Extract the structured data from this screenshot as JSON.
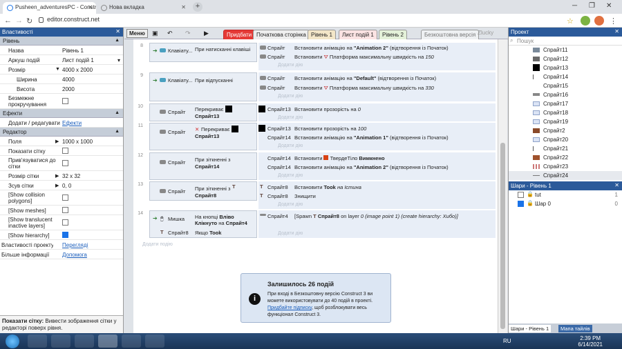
{
  "browser": {
    "tabs": [
      {
        "label": "Pusheen_adventuresPC - Construct"
      },
      {
        "label": "Нова вкладка"
      }
    ],
    "url": "editor.construct.net"
  },
  "left": {
    "title": "Властивості",
    "level_section": "Рівень",
    "name_k": "Назва",
    "name_v": "Рівень 1",
    "sheet_k": "Аркуш подій",
    "sheet_v": "Лист подій 1",
    "size_k": "Розмір",
    "size_v": "4000 x 2000",
    "width_k": "Ширина",
    "width_v": "4000",
    "height_k": "Висота",
    "height_v": "2000",
    "unbounded_k": "Безмежне прокручування",
    "effects_section": "Ефекти",
    "effects_k": "Додати / редагувати",
    "effects_v": "Ефекти",
    "editor_section": "Редактор",
    "margins_k": "Поля",
    "margins_v": "1000 x 1000",
    "grid_k": "Показати сітку",
    "snap_k": "Прив'язуватися до сітки",
    "gridsize_k": "Розмір сітки",
    "gridsize_v": "32 x 32",
    "gridoffset_k": "Зсув сітки",
    "gridoffset_v": "0, 0",
    "collision_k": "[Show collision polygons]",
    "meshes_k": "[Show meshes]",
    "translucent_k": "[Show translucent inactive layers]",
    "hierarchy_k": "[Show hierarchy]",
    "project_k": "Властивості проекту",
    "project_v": "Переглядi",
    "more_k": "Більше інформації",
    "more_v": "Допомога",
    "foot_b": "Показати сітку:",
    "foot_t": " Вивести зображення сітки у редакторі поверх рівня."
  },
  "toolbar": {
    "menu": "Меню",
    "tabs": [
      "Придбати",
      "Початкова сторінка",
      "Рівень 1",
      "Лист подій 1",
      "Рівень 2"
    ],
    "free": "Безкоштовна версія",
    "user": "Zlucky"
  },
  "events": {
    "n8": "8",
    "n9": "9",
    "n10": "10",
    "n11": "11",
    "n12": "12",
    "n13": "13",
    "n14": "14",
    "kb": "Клавіату...",
    "kb_press": "При натисканні клавіші",
    "kb_release": "При відпусканні",
    "sprite": "Спрайт",
    "sprite13": "Спрайт13",
    "sprite14": "Спрайт14",
    "sprite8": "Спрайт8",
    "sprite4": "Спрайт4",
    "set_anim": "Встановити анімацію на",
    "anim2": "\"Animation 2\"",
    "animDef": "\"Default\"",
    "anim1": "\"Animation 1\"",
    "from_start": "(відтворення із Початок)",
    "set_platform": "Платформа максимальну швидкість на",
    "v150": "150",
    "v330": "330",
    "overlap": "Перекриває",
    "not_overlap": "Перекриває",
    "set_opacity": "Встановити прозорість на",
    "op0": "0",
    "op100": "100",
    "collide": "При зіткненні з",
    "solid_set": "Встановити",
    "solid": "ТвердеТіло",
    "solid_off": "Вимкнено",
    "set_took": "Встановити",
    "took": "Took",
    "is_true": "на Істина",
    "destroy": "Знищити",
    "mouse": "Мишка",
    "mouse_click": "На кнопці",
    "left_b": "Вліво",
    "clicked": "Клікнуто",
    "on": "на",
    "if": "Якщо",
    "took2": "Took",
    "spawn": "[Spawn",
    "spawn_rest": "on layer",
    "layer0": "0",
    "spawn_tail": "(image point 1) (create hierarchy: Хибо)]",
    "add_action": "Додати дію",
    "add_event": "Додати подію"
  },
  "notice": {
    "title": "Залишилось 26 подій",
    "text1": "При вході в Безкоштовну версію Construct 3 ви можете використовувати до 40 подій в проекті.",
    "link": "Придбайте підписку",
    "text2": ", щоб розблокувати весь функціонал Construct 3."
  },
  "right": {
    "title": "Проект",
    "search": "Пошук",
    "items": [
      "Спрайт11",
      "Спрайт12",
      "Спрайт13",
      "Спрайт14",
      "Спрайт15",
      "Спрайт16",
      "Спрайт17",
      "Спрайт18",
      "Спрайт19",
      "Спрайт2",
      "Спрайт20",
      "Спрайт21",
      "Спрайт22",
      "Спрайт23",
      "Спрайт24"
    ],
    "layers_title": "Шари - Рівень 1",
    "layer1": "tut",
    "layer1c": "1",
    "layer2": "Шар 0",
    "layer2c": "0",
    "tab1": "Шари - Рівень 1",
    "tab2": "Мапа тайлів"
  },
  "taskbar": {
    "lang": "RU",
    "time": "2:39 PM",
    "date": "6/14/2021"
  }
}
